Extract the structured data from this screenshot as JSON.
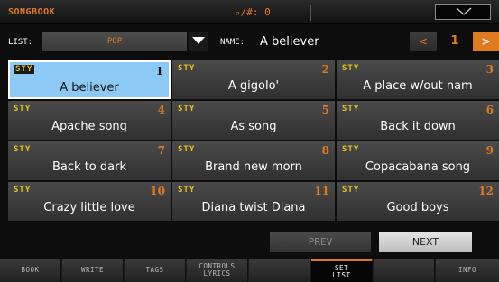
{
  "header": {
    "title": "SONGBOOK",
    "transpose": "♭/#: 0",
    "menu_icon": "chevron-down-icon"
  },
  "list": {
    "label": "LIST:",
    "value": "POP",
    "dropdown_icon": "triangle-down-icon"
  },
  "name": {
    "label": "NAME:",
    "value": "A believer"
  },
  "pager": {
    "prev": "<",
    "page": "1",
    "next": ">"
  },
  "songs": [
    {
      "type": "STY",
      "index": "1",
      "name": "A believer",
      "selected": true
    },
    {
      "type": "STY",
      "index": "2",
      "name": "A gigolo'"
    },
    {
      "type": "STY",
      "index": "3",
      "name": "A place w/out nam"
    },
    {
      "type": "STY",
      "index": "4",
      "name": "Apache song"
    },
    {
      "type": "STY",
      "index": "5",
      "name": "As song"
    },
    {
      "type": "STY",
      "index": "6",
      "name": "Back it down"
    },
    {
      "type": "STY",
      "index": "7",
      "name": "Back to dark"
    },
    {
      "type": "STY",
      "index": "8",
      "name": "Brand new morn"
    },
    {
      "type": "STY",
      "index": "9",
      "name": "Copacabana song"
    },
    {
      "type": "STY",
      "index": "10",
      "name": "Crazy little love"
    },
    {
      "type": "STY",
      "index": "11",
      "name": "Diana twist Diana"
    },
    {
      "type": "STY",
      "index": "12",
      "name": "Good boys"
    }
  ],
  "nav": {
    "prev": "PREV",
    "next": "NEXT"
  },
  "tabs": [
    {
      "line1": "BOOK",
      "line2": ""
    },
    {
      "line1": "WRITE",
      "line2": ""
    },
    {
      "line1": "TAGS",
      "line2": ""
    },
    {
      "line1": "CONTROLS",
      "line2": "LYRICS"
    },
    {
      "line1": "",
      "line2": ""
    },
    {
      "line1": "SET",
      "line2": "LIST",
      "active": true
    },
    {
      "line1": "",
      "line2": ""
    },
    {
      "line1": "INFO",
      "line2": ""
    }
  ],
  "colors": {
    "accent": "#e07a1e",
    "selected": "#8ccaf5",
    "type_label": "#e8c31e"
  }
}
